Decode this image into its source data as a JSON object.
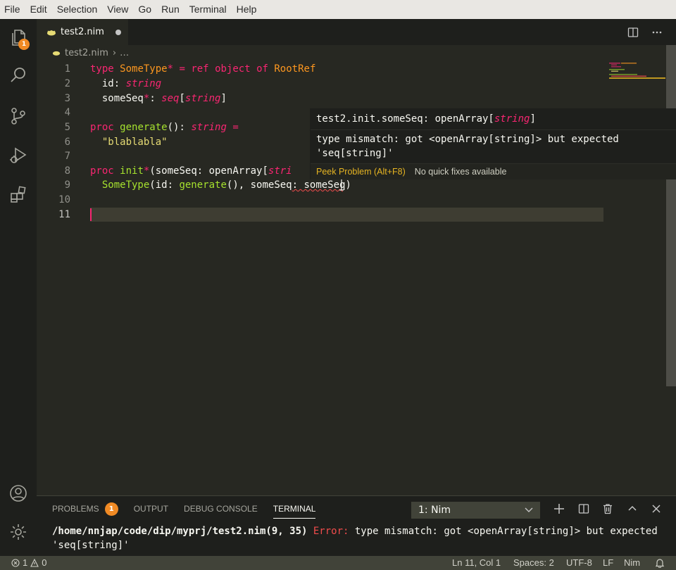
{
  "menubar": {
    "items": [
      "File",
      "Edit",
      "Selection",
      "View",
      "Go",
      "Run",
      "Terminal",
      "Help"
    ]
  },
  "activitybar": {
    "explorer_badge": "1",
    "items": [
      "explorer",
      "search",
      "source-control",
      "run-debug",
      "extensions",
      "accounts",
      "manage"
    ]
  },
  "editor": {
    "tab": {
      "label": "test2.nim",
      "dirty": true
    },
    "breadcrumb": {
      "file": "test2.nim",
      "more": "…"
    },
    "line_numbers": [
      "1",
      "2",
      "3",
      "4",
      "5",
      "6",
      "7",
      "8",
      "9",
      "10",
      "11"
    ],
    "active_line": "11",
    "code": {
      "l1": {
        "kw_type": "type",
        "name": "SomeType",
        "star": "*",
        "eq": " = ",
        "kw_ref": "ref",
        "kw_object": "object",
        "kw_of": "of",
        "base": "RootRef"
      },
      "l2": {
        "field": "id",
        "colon": ": ",
        "ftype": "string"
      },
      "l3": {
        "field": "someSeq",
        "star": "*",
        "colon": ": ",
        "seq": "seq",
        "lb": "[",
        "inner": "string",
        "rb": "]"
      },
      "l5": {
        "kw_proc": "proc",
        "name": "generate",
        "parens": "(): ",
        "rtype": "string",
        "eq": " ="
      },
      "l6": {
        "str": "\"blablabla\""
      },
      "l8": {
        "kw_proc": "proc",
        "name": "init",
        "star": "*",
        "open": "(someSeq: openArray[",
        "partial": "stri"
      },
      "l9": {
        "ctor": "SomeType",
        "open": "(id: ",
        "fncall": "generate",
        "mid": "(), someSeq",
        "errpart": ": someSeq",
        "close": ")"
      }
    }
  },
  "hover": {
    "signature_prefix": "test2.init.someSeq: openArray[",
    "signature_type": "string",
    "signature_suffix": "]",
    "message": "type mismatch: got <openArray[string]> but expected 'seq[string]'",
    "peek_label": "Peek Problem (Alt+F8)",
    "no_fix_label": "No quick fixes available"
  },
  "panel": {
    "tabs": [
      {
        "label": "PROBLEMS",
        "badge": "1"
      },
      {
        "label": "OUTPUT"
      },
      {
        "label": "DEBUG CONSOLE"
      },
      {
        "label": "TERMINAL",
        "active": true
      }
    ],
    "terminal_select": "1: Nim",
    "output_path": "/home/nnjap/code/dip/myprj/test2.nim(9, 35)",
    "output_error_label": "Error:",
    "output_message": " type mismatch: got <openArray[string]> but expected 'seq[string]'"
  },
  "statusbar": {
    "errors": "1",
    "warnings": "0",
    "position": "Ln 11, Col 1",
    "indent": "Spaces: 2",
    "encoding": "UTF-8",
    "eol": "LF",
    "language": "Nim"
  },
  "colors": {
    "keyword": "#f92672",
    "type": "#fd971f",
    "function": "#a6e22e",
    "string": "#e6db74",
    "badge": "#f08a24",
    "peek": "#e6b422",
    "error": "#f14c4c"
  }
}
